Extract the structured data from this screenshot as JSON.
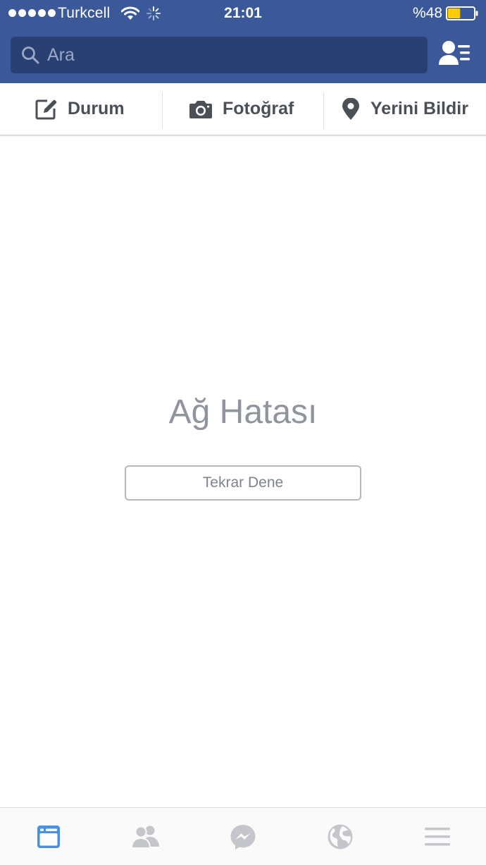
{
  "status_bar": {
    "carrier": "Turkcell",
    "time": "21:01",
    "battery_percent": "%48",
    "battery_level": 0.48,
    "battery_color": "#ffcc00",
    "icons": [
      "signal-dots-icon",
      "wifi-icon",
      "activity-spinner-icon",
      "battery-icon"
    ]
  },
  "search": {
    "placeholder": "Ara",
    "value": "",
    "icon": "search-icon"
  },
  "header": {
    "background": "#3b5998",
    "friend_requests_icon": "friend-requests-icon"
  },
  "composer": {
    "items": [
      {
        "label": "Durum",
        "icon": "edit-icon"
      },
      {
        "label": "Fotoğraf",
        "icon": "camera-icon"
      },
      {
        "label": "Yerini Bildir",
        "icon": "location-pin-icon"
      }
    ]
  },
  "error": {
    "title": "Ağ Hatası",
    "retry_label": "Tekrar Dene"
  },
  "tab_bar": {
    "active_color": "#4a90e2",
    "inactive_color": "#c4c6cb",
    "tabs": [
      {
        "name": "news-feed",
        "icon": "news-feed-icon",
        "active": true
      },
      {
        "name": "friends",
        "icon": "friends-icon",
        "active": false
      },
      {
        "name": "messenger",
        "icon": "messenger-icon",
        "active": false
      },
      {
        "name": "notifications",
        "icon": "globe-icon",
        "active": false
      },
      {
        "name": "menu",
        "icon": "menu-icon",
        "active": false
      }
    ]
  }
}
